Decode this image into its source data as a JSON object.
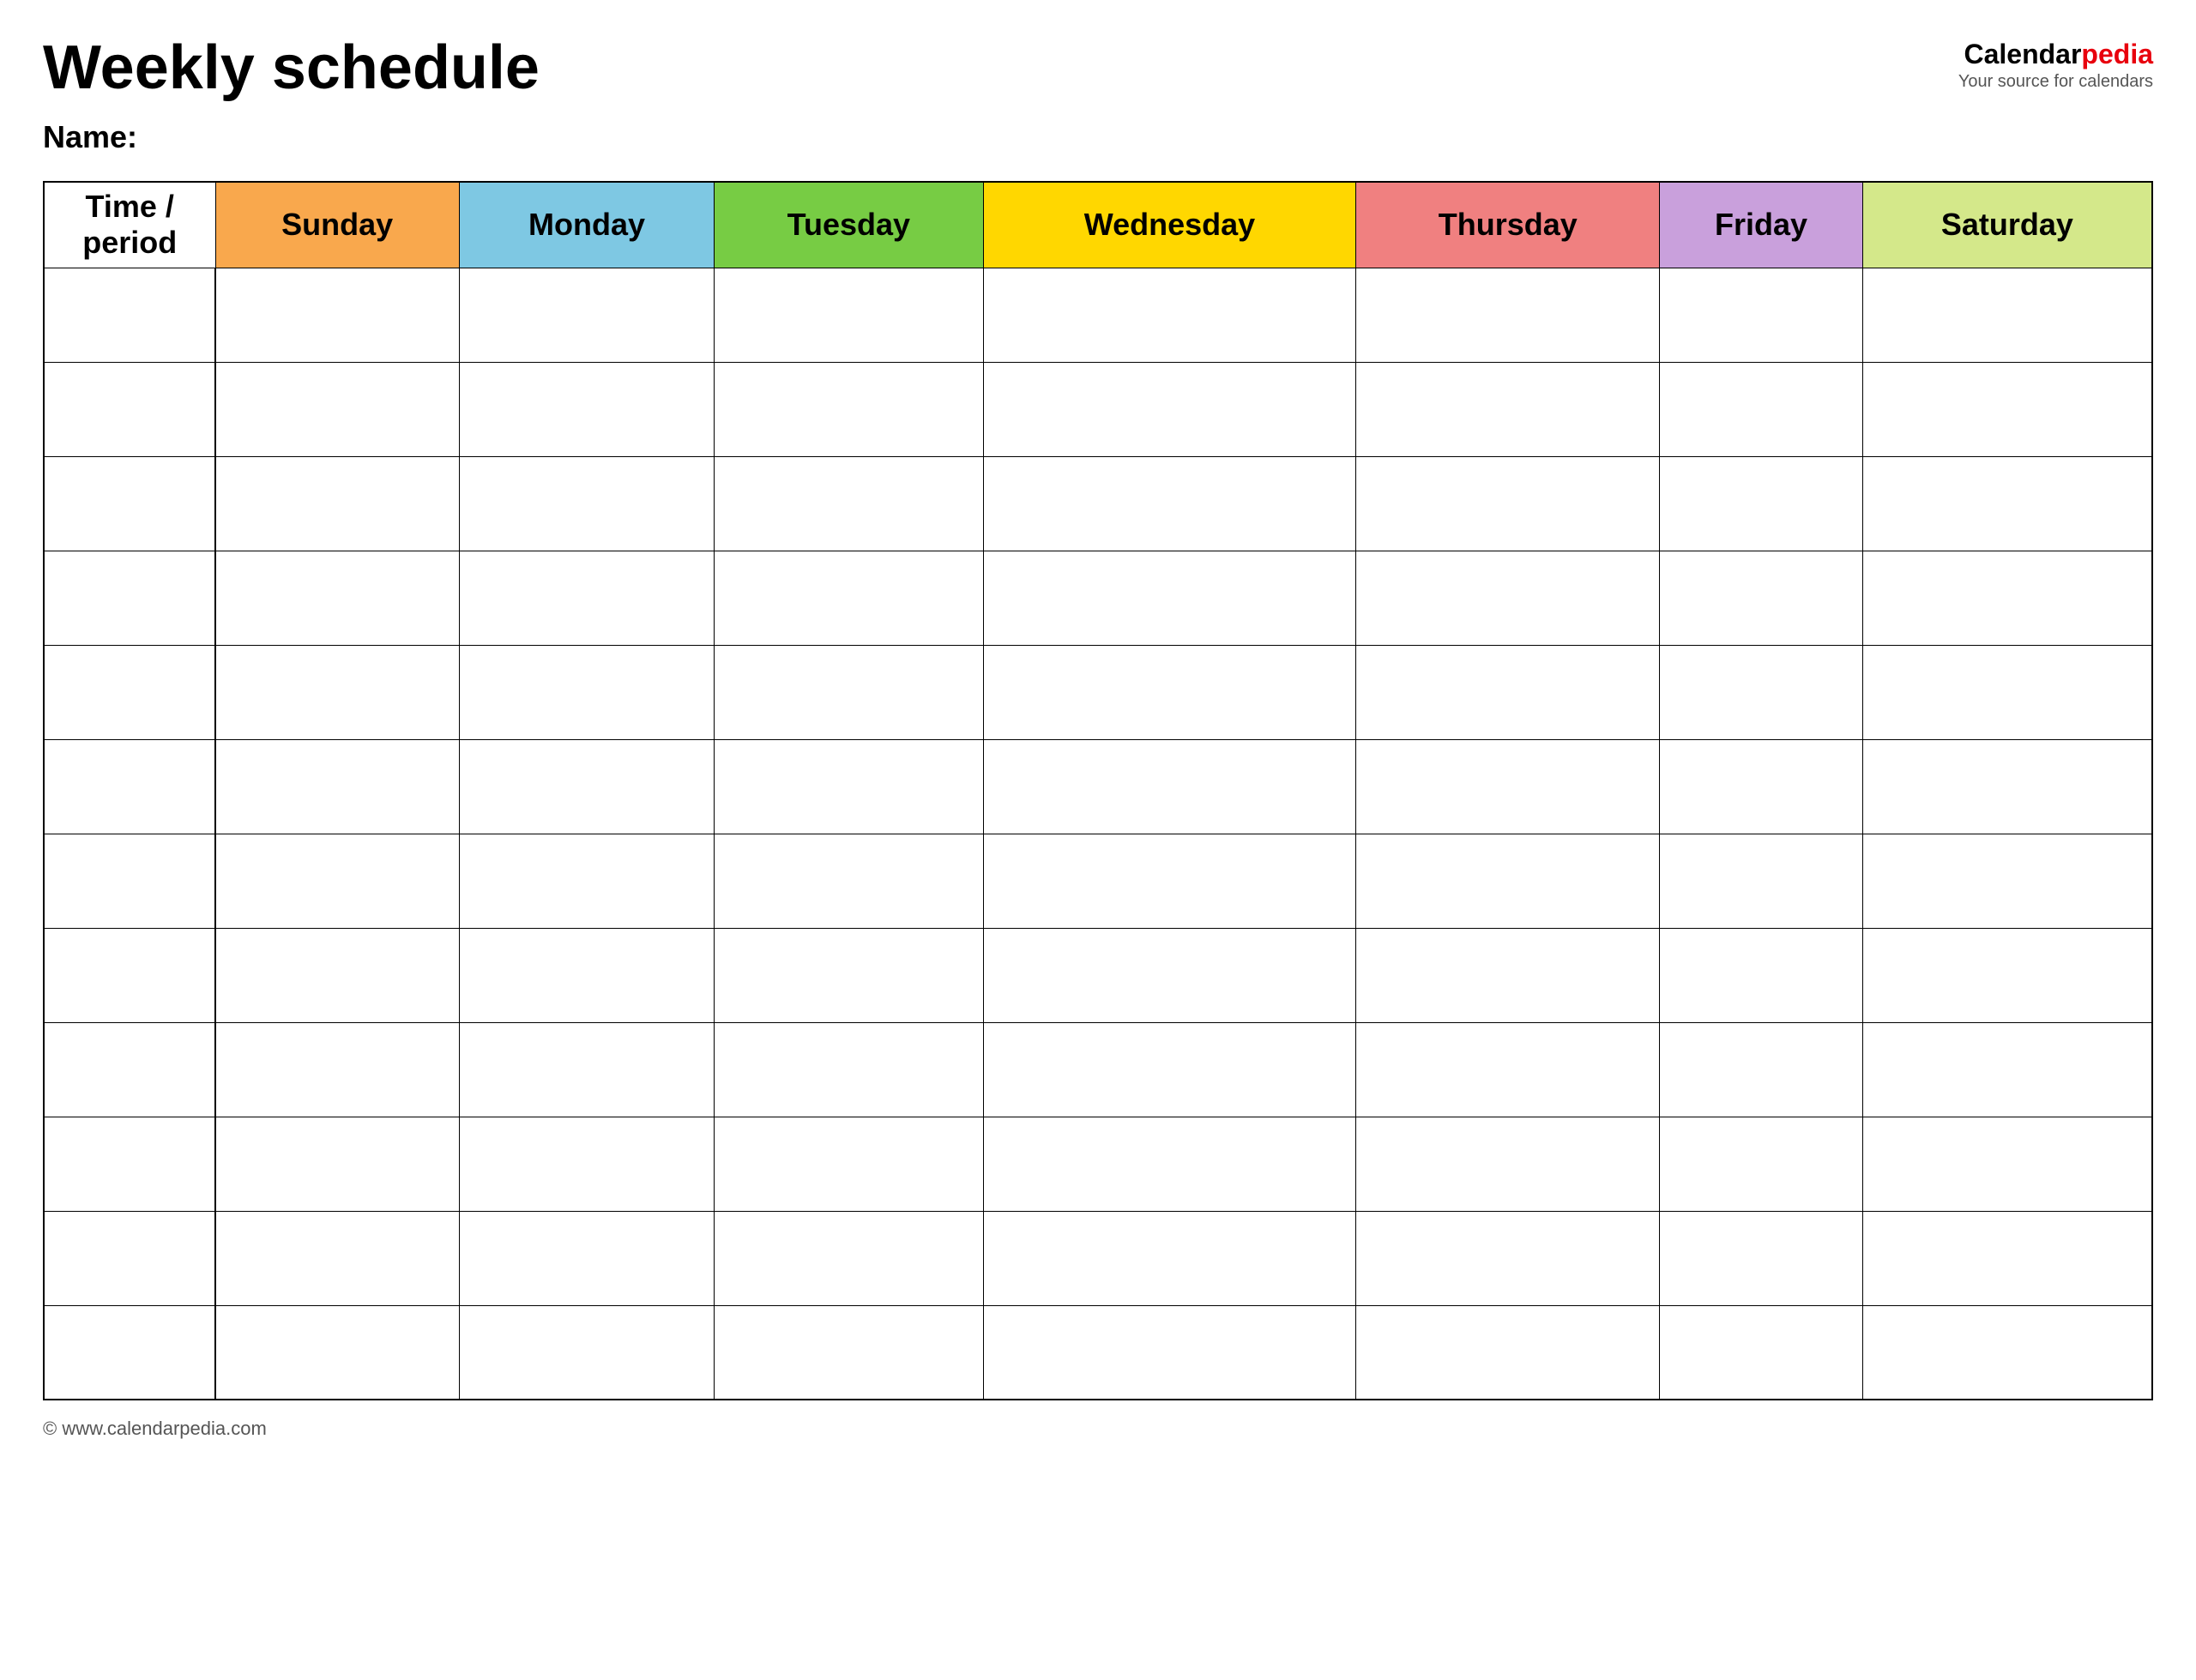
{
  "page": {
    "title": "Weekly schedule",
    "name_label": "Name:",
    "footer_text": "© www.calendarpedia.com"
  },
  "logo": {
    "part1": "Calendar",
    "part2": "pedia",
    "tagline": "Your source for calendars"
  },
  "table": {
    "time_col_header": "Time / period",
    "days": [
      {
        "label": "Sunday",
        "color_class": "col-sunday"
      },
      {
        "label": "Monday",
        "color_class": "col-monday"
      },
      {
        "label": "Tuesday",
        "color_class": "col-tuesday"
      },
      {
        "label": "Wednesday",
        "color_class": "col-wednesday"
      },
      {
        "label": "Thursday",
        "color_class": "col-thursday"
      },
      {
        "label": "Friday",
        "color_class": "col-friday"
      },
      {
        "label": "Saturday",
        "color_class": "col-saturday"
      }
    ],
    "row_count": 12
  }
}
